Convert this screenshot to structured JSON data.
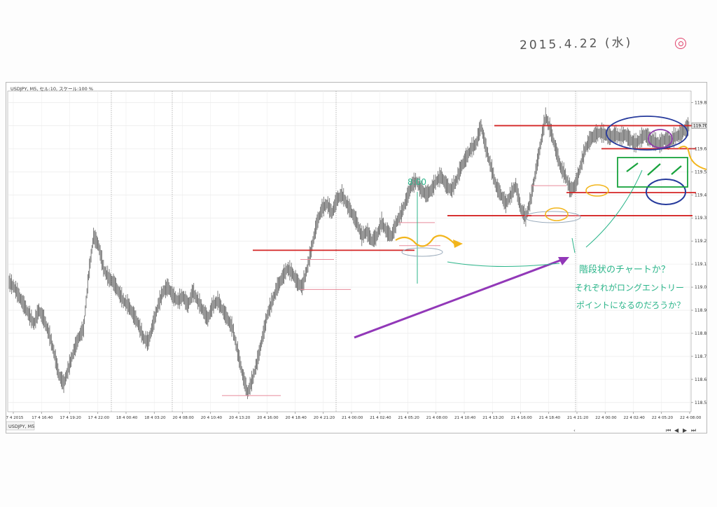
{
  "header": {
    "date_note": "2015.4.22 (水)",
    "symbol_info": "USDJPY, M5, セル:10, スケール:100 %",
    "current_price": "119.70",
    "tab_label": "USDJPY, M5"
  },
  "annotations": {
    "time_note": "8:00",
    "question_lines": [
      "階段状のチャートか？",
      "それぞれがロングエントリー",
      "ポイントになるのだろうか？"
    ]
  },
  "colors": {
    "candles": "#6e6e6e",
    "support_lines": "#d42525",
    "arrow": "#9238b8",
    "highlight_yellow": "#f2b51b",
    "ellipse_navy": "#263a9c",
    "ellipse_purple": "#8c3aa8",
    "box_green": "#18a33d",
    "note_teal": "#2bb58a"
  },
  "chart_data": {
    "type": "line",
    "title": "USDJPY, M5",
    "xlabel": "",
    "ylabel": "",
    "ylim": [
      118.46,
      119.85
    ],
    "x_tick_labels": [
      "17 4 2015",
      "17 4 16:40",
      "17 4 19:20",
      "17 4 22:00",
      "18 4 00:40",
      "18 4 03:20",
      "20 4 08:00",
      "20 4 10:40",
      "20 4 13:20",
      "20 4 16:00",
      "20 4 18:40",
      "20 4 21:20",
      "21 4 00:00",
      "21 4 02:40",
      "21 4 05:20",
      "21 4 08:00",
      "21 4 10:40",
      "21 4 13:20",
      "21 4 16:00",
      "21 4 18:40",
      "21 4 21:20",
      "22 4 00:00",
      "22 4 02:40",
      "22 4 05:20",
      "22 4 08:00"
    ],
    "y_ticks": [
      118.5,
      118.6,
      118.7,
      118.8,
      118.9,
      119.0,
      119.1,
      119.2,
      119.3,
      119.4,
      119.5,
      119.6,
      119.7,
      119.8
    ],
    "y_tick_labels": [
      "118.50",
      "118.60",
      "118.70",
      "118.80",
      "118.90",
      "119.00",
      "119.10",
      "119.20",
      "119.30",
      "119.40",
      "119.50",
      "119.60",
      "119.70",
      "119.80"
    ],
    "grid": true,
    "series": [
      {
        "values": [
          119.02,
          119.0,
          118.96,
          118.92,
          118.88,
          118.84,
          118.9,
          118.86,
          118.8,
          118.72,
          118.62,
          118.58,
          118.65,
          118.72,
          118.78,
          118.82,
          119.05,
          119.22,
          119.18,
          119.08,
          119.04,
          119.02,
          118.98,
          118.94,
          118.92,
          118.88,
          118.84,
          118.78,
          118.76,
          118.84,
          118.92,
          118.98,
          119.0,
          118.96,
          118.94,
          118.96,
          118.92,
          118.98,
          118.94,
          118.9,
          118.86,
          118.92,
          118.94,
          118.9,
          118.86,
          118.82,
          118.72,
          118.62,
          118.54,
          118.6,
          118.68,
          118.78,
          118.88,
          118.94,
          119.0,
          119.04,
          119.08,
          119.06,
          119.02,
          119.0,
          119.08,
          119.18,
          119.28,
          119.34,
          119.36,
          119.32,
          119.38,
          119.4,
          119.36,
          119.32,
          119.28,
          119.22,
          119.24,
          119.2,
          119.22,
          119.28,
          119.24,
          119.22,
          119.28,
          119.32,
          119.38,
          119.44,
          119.46,
          119.42,
          119.4,
          119.42,
          119.46,
          119.48,
          119.44,
          119.42,
          119.46,
          119.52,
          119.56,
          119.6,
          119.62,
          119.7,
          119.6,
          119.52,
          119.44,
          119.4,
          119.36,
          119.4,
          119.44,
          119.34,
          119.3,
          119.38,
          119.5,
          119.62,
          119.74,
          119.68,
          119.6,
          119.52,
          119.48,
          119.42,
          119.44,
          119.52,
          119.6,
          119.64,
          119.66,
          119.67,
          119.66,
          119.65,
          119.66,
          119.65,
          119.66,
          119.64,
          119.62,
          119.64,
          119.66,
          119.64,
          119.63,
          119.62,
          119.64,
          119.63,
          119.65,
          119.66,
          119.68,
          119.7
        ]
      }
    ],
    "support_levels": [
      119.16,
      119.31,
      119.41,
      119.6,
      119.7
    ]
  }
}
